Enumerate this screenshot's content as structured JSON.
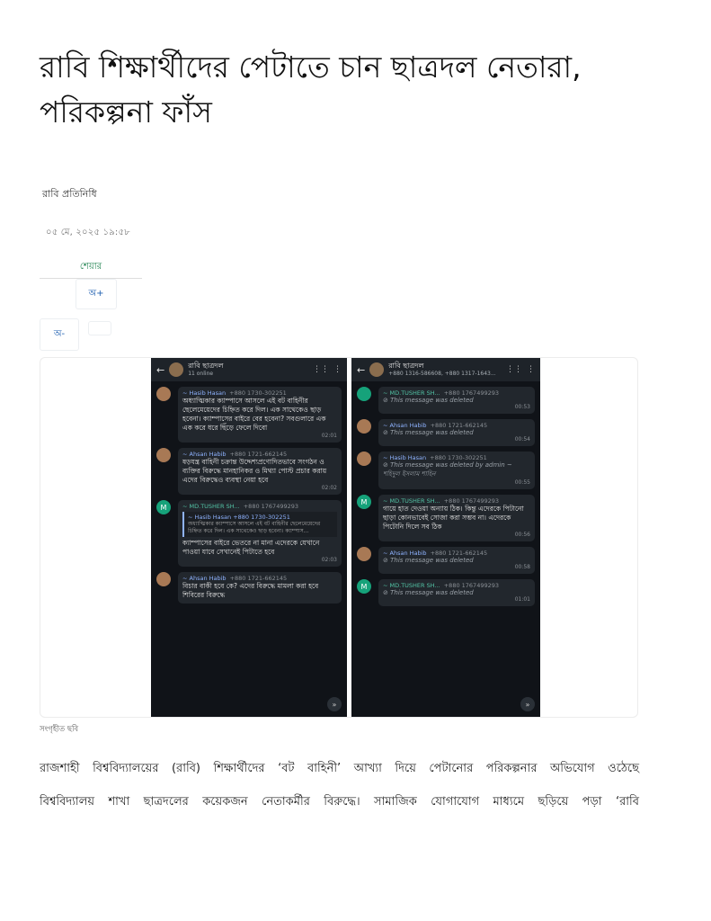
{
  "article": {
    "headline": "রাবি শিক্ষার্থীদের পেটাতে চান ছাত্রদল নেতারা, পরিকল্পনা ফাঁস",
    "byline": "রাবি প্রতিনিধি",
    "published": "০৫ মে, ২০২৫ ১৯:৫৮",
    "share_label": "শেয়ার",
    "font_increase_label": "অ+",
    "font_decrease_label": "অ-",
    "image_caption": "সংগৃহীত ছবি",
    "body_line_1": "রাজশাহী বিশ্ববিদ্যালয়ের (রাবি) শিক্ষার্থীদের ‘বট বাহিনী’ আখ্যা দিয়ে পেটানোর পরিকল্পনার অভিযোগ ওঠেছে",
    "body_line_2": "বিশ্ববিদ্যালয় শাখা ছাত্রদলের কয়েকজন নেতাকর্মীর বিরুদ্ধে। সামাজিক যোগাযোগ মাধ্যমে ছড়িয়ে পড়া ‘রাবি"
  },
  "screenshot_left": {
    "group_name": "রাবি ছাত্রদল",
    "group_sub": "11 online",
    "messages": [
      {
        "sender": "~ Hasib Hasan",
        "phone": "+880 1730-302251",
        "text": "অধ্যাত্মিকার ক্যাম্পাসে আসলে এই বট বাহিনীর ছেলেমেয়েদের চিহ্নিত করে দিল। এক সাথেকেও ছাড় হবেনা। ক্যাম্পাসের বাইরে বের হবেনা? সবগুলারে এক এক করে ধরে ছিঁড়ে ফেলে দিবো",
        "time": "02:01"
      },
      {
        "sender": "~ Ahsan Habib",
        "phone": "+880 1721-662145",
        "text": "ষড়যন্ত্র বাহিনী চক্রান্ত উদ্দেশ্যপ্রণোদিতভাবে সংগঠন ও ব্যক্তির বিরুদ্ধে মানহানিকর ও মিথ্যা পোস্ট প্রচার করায় এদের বিরুদ্ধেও ব্যবস্থা নেয়া হবে",
        "time": "02:02"
      },
      {
        "sender": "~ MD.TUSHER SH...",
        "phone": "+880 1767499293",
        "quote_name": "~ Hasib Hasan",
        "quote_phone": "+880 1730-302251",
        "quote_text": "অধ্যাত্মিকার ক্যাম্পাসে আসলে এই বট বাহিনীর ছেলেমেয়েদের চিহ্নিত করে দিল। এক সাথেকেও ছাড় হবেনা। ক্যাম্পাস...",
        "text": "ক্যাম্পাসের বাইরে ভেতরে না মানা এদেরকে যেখানে পাওয়া যাবে সেখানেই পিটাতে হবে",
        "time": "02:03"
      },
      {
        "sender": "~ Ahsan Habib",
        "phone": "+880 1721-662145",
        "text": "বিচার বাকী হবে কে? এদের বিরুদ্ধে মামলা করা হবে শিবিরের বিরুদ্ধে",
        "time": ""
      }
    ]
  },
  "screenshot_right": {
    "group_name": "রাবি ছাত্রদল",
    "group_sub": "+880 1316-586608, +880 1317-1643...",
    "messages": [
      {
        "sender": "~ MD.TUSHER SH...",
        "phone": "+880 1767499293",
        "deleted": "This message was deleted",
        "time": "00:53"
      },
      {
        "sender": "~ Ahsan Habib",
        "phone": "+880 1721-662145",
        "deleted": "This message was deleted",
        "time": "00:54"
      },
      {
        "sender": "~ Hasib Hasan",
        "phone": "+880 1730-302251",
        "deleted": "This message was deleted by admin ~ শহিদুল ইসলাম শাহিন",
        "time": "00:55"
      },
      {
        "sender": "~ MD.TUSHER SH...",
        "phone": "+880 1767499293",
        "text": "গায়ে হাত দেওয়া অন্যায় ঠিক। কিন্তু এদেরকে পিটানো ছাড়া কোনভাবেই সোজা করা সম্ভব না। এদেরকে পিটোনি দিলে সব ঠিক",
        "time": "00:56"
      },
      {
        "sender": "~ Ahsan Habib",
        "phone": "+880 1721-662145",
        "deleted": "This message was deleted",
        "time": "00:58"
      },
      {
        "sender": "~ MD.TUSHER SH...",
        "phone": "+880 1767499293",
        "deleted": "This message was deleted",
        "time": "01:01"
      }
    ]
  },
  "icons": {
    "back": "arrow-left-icon",
    "audio": "audio-wave-icon",
    "menu": "kebab-menu-icon",
    "deleted": "blocked-circle-icon",
    "scroll": "chevron-double-down-icon"
  }
}
